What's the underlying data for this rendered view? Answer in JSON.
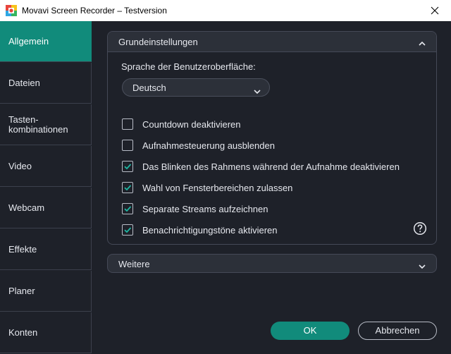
{
  "window": {
    "title": "Movavi Screen Recorder – Testversion"
  },
  "sidebar": {
    "items": [
      {
        "label": "Allgemein",
        "active": true
      },
      {
        "label": "Dateien"
      },
      {
        "label": "Tasten-\nkombinationen"
      },
      {
        "label": "Video"
      },
      {
        "label": "Webcam"
      },
      {
        "label": "Effekte"
      },
      {
        "label": "Planer"
      },
      {
        "label": "Konten"
      }
    ]
  },
  "basic_settings": {
    "title": "Grundeinstellungen",
    "expanded": true,
    "language_label": "Sprache der Benutzeroberfläche:",
    "language_value": "Deutsch",
    "options": [
      {
        "label": "Countdown deaktivieren",
        "checked": false
      },
      {
        "label": "Aufnahmesteuerung ausblenden",
        "checked": false
      },
      {
        "label": "Das Blinken des Rahmens während der Aufnahme deaktivieren",
        "checked": true
      },
      {
        "label": "Wahl von Fensterbereichen zulassen",
        "checked": true
      },
      {
        "label": "Separate Streams aufzeichnen",
        "checked": true
      },
      {
        "label": "Benachrichtigungstöne aktivieren",
        "checked": true
      }
    ],
    "help_icon": "question-circle-icon"
  },
  "more_settings": {
    "title": "Weitere",
    "expanded": false
  },
  "footer": {
    "ok_label": "OK",
    "cancel_label": "Abbrechen"
  },
  "colors": {
    "accent": "#118b7b",
    "background": "#1e2129",
    "header_bg": "#2c3039",
    "border": "#454957",
    "text": "#e6e8ee"
  }
}
